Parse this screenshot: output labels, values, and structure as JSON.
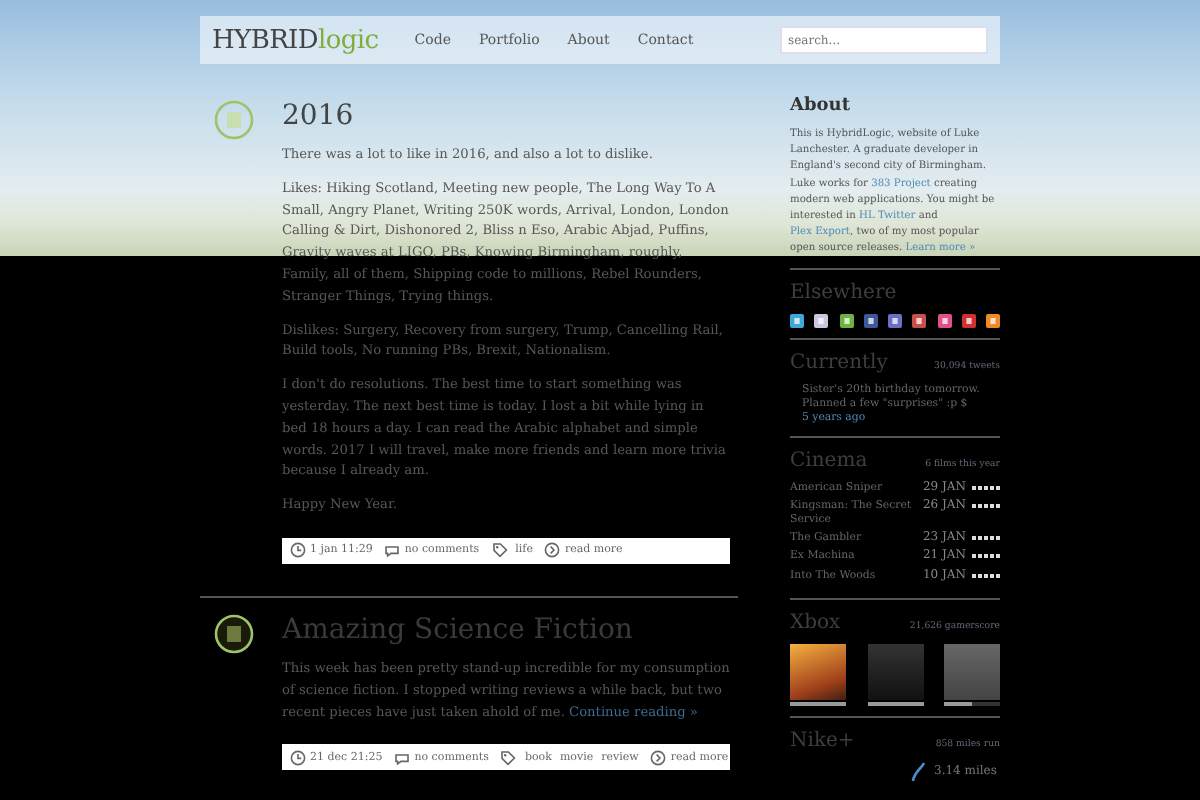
{
  "header": {
    "logo": {
      "main": "HYBRID",
      "accent": "logic"
    },
    "nav": [
      {
        "label": "Code"
      },
      {
        "label": "Portfolio"
      },
      {
        "label": "About"
      },
      {
        "label": "Contact"
      }
    ],
    "search": {
      "placeholder": "search..."
    }
  },
  "posts": [
    {
      "title": "2016",
      "paragraphs": [
        "There was a lot to like in 2016, and also a lot to dislike.",
        "Likes: Hiking Scotland, Meeting new people, The Long Way To A Small, Angry Planet, Writing 250K words, Arrival, London, London Calling & Dirt, Dishonored 2, Bliss n Eso, Arabic Abjad, Puffins, Gravity waves at LIGO, PBs, Knowing Birmingham, roughly, Family, all of them, Shipping code to millions, Rebel Rounders, Stranger Things, Trying things.",
        "Dislikes: Surgery, Recovery from surgery, Trump, Cancelling Rail, Build tools, No running PBs, Brexit, Nationalism.",
        "I don't do resolutions. The best time to start something was yesterday. The next best time is today. I lost a bit while lying in bed 18 hours a day. I can read the Arabic alphabet and simple words. 2017 I will travel, make more friends and learn more trivia because I already am.",
        "Happy New Year."
      ],
      "date": "1 jan 11:29",
      "comments": "no comments",
      "tags": [
        "life"
      ],
      "more": "read more"
    },
    {
      "title": "Amazing Science Fiction",
      "paragraphs": [
        "This week has been pretty stand-up incredible for my consumption of science fiction. I stopped writing reviews a while back, but two recent pieces have just taken ahold of me."
      ],
      "continue": "Continue reading »",
      "date": "21 dec 21:25",
      "comments": "no comments",
      "tags": [
        "book",
        "movie",
        "review"
      ],
      "more": "read more"
    }
  ],
  "sidebar": {
    "about": {
      "heading": "About",
      "segments": [
        {
          "text": "This is HybridLogic, website of Luke Lanchester. A graduate developer in England's second city of Birmingham. Luke works for ",
          "link": false
        },
        {
          "text": "383 Project",
          "link": true
        },
        {
          "text": " creating modern web applications. You might be interested in ",
          "link": false
        },
        {
          "text": "HL Twitter",
          "link": true
        },
        {
          "text": " and ",
          "link": false
        },
        {
          "text": "Plex Export",
          "link": true
        },
        {
          "text": ", two of my most popular open source releases. ",
          "link": false
        },
        {
          "text": "Learn more »",
          "link": true
        }
      ]
    },
    "elsewhere": {
      "heading": "Elsewhere",
      "icons": [
        {
          "color": "#3ea9d8"
        },
        {
          "color": "#c8c8e0"
        },
        {
          "color": "#6cb33f"
        },
        {
          "color": "#3b5998"
        },
        {
          "color": "#6e6ec8"
        },
        {
          "color": "#c8504a"
        },
        {
          "color": "#e0508a"
        },
        {
          "color": "#d03030"
        },
        {
          "color": "#f08a24"
        }
      ]
    },
    "currently": {
      "heading": "Currently",
      "count": "30,094 tweets",
      "status": "Sister's 20th birthday tomorrow. Planned a few \"surprises\" :p $",
      "time": "5 years ago"
    },
    "cinema": {
      "heading": "Cinema",
      "count": "6 films this year",
      "films": [
        {
          "title": "American Sniper",
          "date": "29 JAN",
          "stars": 5
        },
        {
          "title": "Kingsman: The Secret Service",
          "date": "26 JAN",
          "stars": 5
        },
        {
          "title": "The Gambler",
          "date": "23 JAN",
          "stars": 5
        },
        {
          "title": "Ex Machina",
          "date": "21 JAN",
          "stars": 5
        },
        {
          "title": "Into The Woods",
          "date": "10 JAN",
          "stars": 5
        }
      ]
    },
    "xbox": {
      "heading": "Xbox",
      "count": "21,626 gamerscore",
      "games": [
        {
          "level": 1.0
        },
        {
          "level": 1.0
        },
        {
          "level": 0.5
        }
      ]
    },
    "nike": {
      "heading": "Nike+",
      "count": "858 miles run",
      "distance": "3.14 miles"
    }
  }
}
